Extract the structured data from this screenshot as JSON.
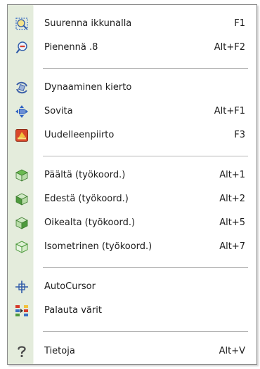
{
  "menu": {
    "items": [
      {
        "label": "Suurenna ikkunalla",
        "shortcut": "F1",
        "icon": "zoom-window-icon"
      },
      {
        "label": "Pienennä .8",
        "shortcut": "Alt+F2",
        "icon": "zoom-out-icon"
      },
      {
        "label": "Dynaaminen kierto",
        "shortcut": "",
        "icon": "dynamic-rotate-icon"
      },
      {
        "label": "Sovita",
        "shortcut": "Alt+F1",
        "icon": "fit-icon"
      },
      {
        "label": "Uudelleenpiirto",
        "shortcut": "F3",
        "icon": "redraw-icon"
      },
      {
        "label": "Päältä (työkoord.)",
        "shortcut": "Alt+1",
        "icon": "view-top-icon"
      },
      {
        "label": "Edestä (työkoord.)",
        "shortcut": "Alt+2",
        "icon": "view-front-icon"
      },
      {
        "label": "Oikealta (työkoord.)",
        "shortcut": "Alt+5",
        "icon": "view-right-icon"
      },
      {
        "label": "Isometrinen (työkoord.)",
        "shortcut": "Alt+7",
        "icon": "view-isometric-icon"
      },
      {
        "label": "AutoCursor",
        "shortcut": "",
        "icon": "autocursor-icon"
      },
      {
        "label": "Palauta värit",
        "shortcut": "",
        "icon": "restore-colors-icon"
      },
      {
        "label": "Tietoja",
        "shortcut": "Alt+V",
        "icon": "help-icon"
      }
    ]
  },
  "colors": {
    "icon_strip": "#e4ecdc",
    "border": "#8c8c8c",
    "separator": "#b4b4b4",
    "text": "#1c1c1c",
    "cube_green": "#4e9a3e"
  }
}
